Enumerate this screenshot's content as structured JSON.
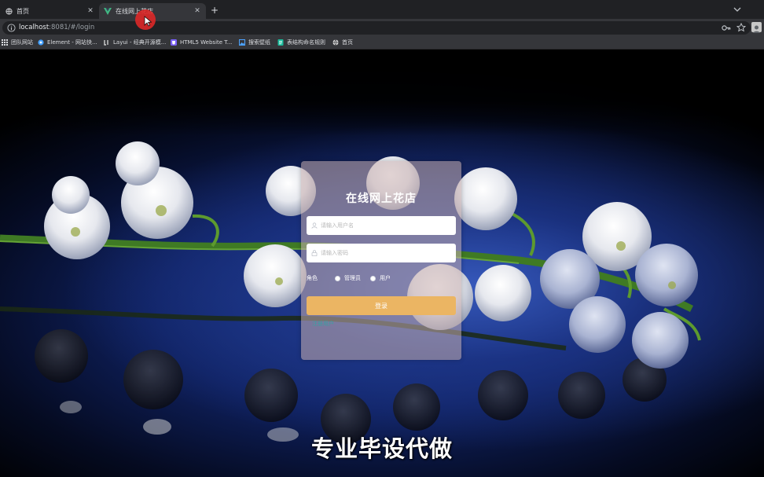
{
  "browser": {
    "tabs": [
      {
        "title": "首页",
        "active": false
      },
      {
        "title": "在线网上花店",
        "active": true
      }
    ],
    "new_tab_symbol": "+",
    "url_host": "localhost",
    "url_rest": ":8081/#/login",
    "bookmarks": [
      {
        "label": "团队网站",
        "icon": "folder-icon",
        "color": "#f2b705"
      },
      {
        "label": "Element - 网站快...",
        "icon": "element-logo-icon",
        "color": "#409eff"
      },
      {
        "label": "Layui - 经典开源模...",
        "icon": "layui-icon",
        "color": "#e8e8e8"
      },
      {
        "label": "HTML5 Website T...",
        "icon": "html5-icon",
        "color": "#7b61ff"
      },
      {
        "label": "搜索壁纸",
        "icon": "wallpaper-icon",
        "color": "#4da3ff"
      },
      {
        "label": "表结构命名规则",
        "icon": "doc-icon",
        "color": "#1abc9c"
      },
      {
        "label": "首页",
        "icon": "globe-icon",
        "color": "#e8e8e8"
      }
    ]
  },
  "login": {
    "title": "在线网上花店",
    "username_placeholder": "请输入用户名",
    "password_placeholder": "请输入密码",
    "role_label": "角色",
    "role_options": [
      "管理员",
      "用户"
    ],
    "submit_label": "登录",
    "register_label": "注册用户",
    "button_color": "#ebb563"
  },
  "caption": "专业毕设代做"
}
